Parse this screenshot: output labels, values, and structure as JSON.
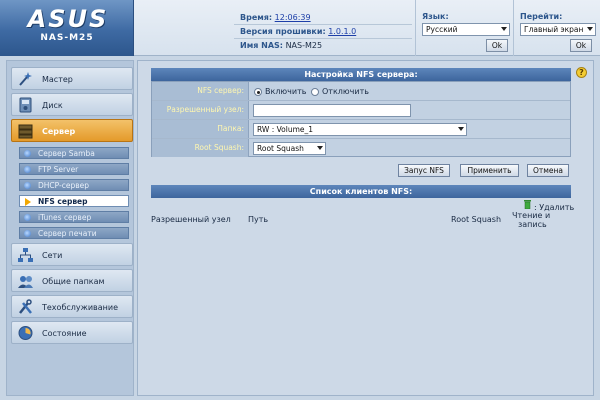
{
  "header": {
    "logo": "ASUS",
    "model": "NAS-M25",
    "time_label": "Время:",
    "time_value": "12:06:39",
    "firmware_label": "Версия прошивки:",
    "firmware_value": "1.0.1.0",
    "nas_name_label": "Имя NAS:",
    "nas_name_value": "NAS-M25",
    "language_label": "Язык:",
    "language_selected": "Русский",
    "language_ok": "Ok",
    "goto_label": "Перейти:",
    "goto_selected": "Главный экран",
    "goto_ok": "Ok"
  },
  "sidebar": {
    "items": [
      {
        "label": "Мастер",
        "icon": "wizard-icon"
      },
      {
        "label": "Диск",
        "icon": "disk-icon"
      },
      {
        "label": "Сервер",
        "icon": "server-icon",
        "active": true
      },
      {
        "label": "Сети",
        "icon": "network-icon"
      },
      {
        "label": "Общие папкам",
        "icon": "shared-folders-icon"
      },
      {
        "label": "Техобслуживание",
        "icon": "tools-icon"
      },
      {
        "label": "Состояние",
        "icon": "status-icon"
      }
    ],
    "sub_items": [
      {
        "label": "Сервер Samba"
      },
      {
        "label": "FTP Server"
      },
      {
        "label": "DHCP-сервер"
      },
      {
        "label": "NFS сервер",
        "active": true
      },
      {
        "label": "iTunes сервер"
      },
      {
        "label": "Сервер печати"
      }
    ]
  },
  "nfs_settings": {
    "title": "Настройка NFS сервера:",
    "nfs_server_label": "NFS сервер:",
    "enable_label": "Включить",
    "disable_label": "Отключить",
    "allowed_host_label": "Разрешенный узел:",
    "allowed_host_value": "",
    "folder_label": "Папка:",
    "folder_value": "RW : Volume_1",
    "root_squash_label": "Root Squash:",
    "root_squash_value": "Root Squash",
    "btn_start": "Запус NFS",
    "btn_apply": "Применить",
    "btn_cancel": "Отмена"
  },
  "client_list": {
    "title": "Список клиентов NFS:",
    "delete_label": ": Удалить",
    "col_host": "Разрешенный узел",
    "col_path": "Путь",
    "col_root_squash": "Root Squash",
    "col_rw_line1": "Чтение и",
    "col_rw_line2": "запись"
  },
  "colors": {
    "accent_blue": "#3d659d",
    "active_orange": "#e49a2a",
    "label_yellow": "#fff7b0"
  }
}
